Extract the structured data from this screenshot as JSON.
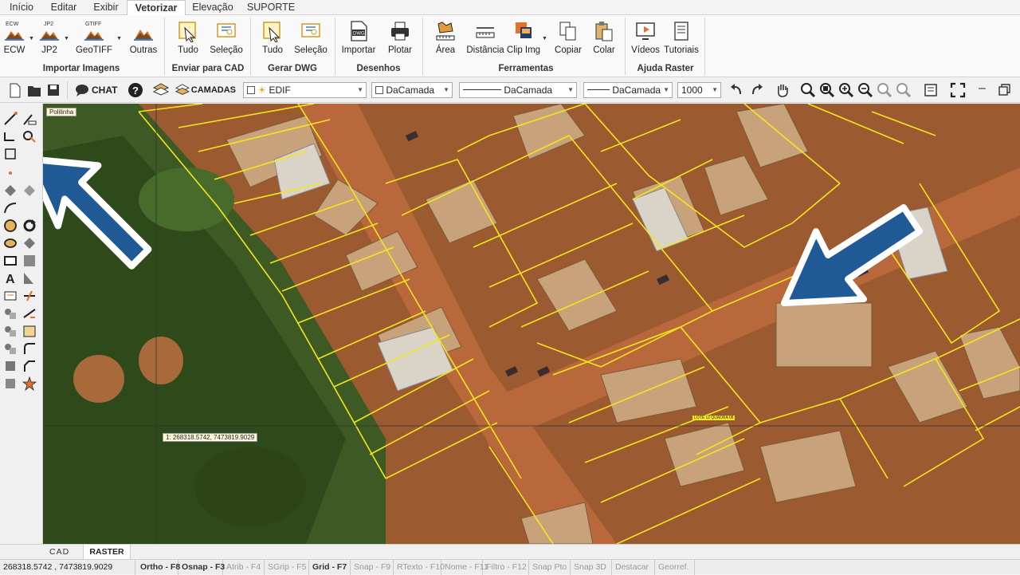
{
  "menu_tabs": [
    "Início",
    "Editar",
    "Exibir",
    "Vetorizar",
    "Elevação",
    "SUPORTE"
  ],
  "active_tab": "Vetorizar",
  "ribbon": {
    "importar": {
      "group": "Importar Imagens",
      "buttons": [
        "ECW",
        "JP2",
        "GeoTIFF",
        "Outras"
      ],
      "badges": [
        "ECW",
        "JP2",
        "GTIFF"
      ]
    },
    "enviar": {
      "group": "Enviar para CAD",
      "buttons": [
        "Tudo",
        "Seleção"
      ]
    },
    "gerar": {
      "group": "Gerar DWG",
      "buttons": [
        "Tudo",
        "Seleção"
      ]
    },
    "desenhos": {
      "group": "Desenhos",
      "buttons": [
        "Importar",
        "Plotar"
      ],
      "badge": "DWG"
    },
    "ferramentas": {
      "group": "Ferramentas",
      "buttons": [
        "Área",
        "Distância",
        "Clip Img",
        "Copiar",
        "Colar"
      ]
    },
    "ajuda": {
      "group": "Ajuda Raster",
      "buttons": [
        "Vídeos",
        "Tutoriais"
      ]
    }
  },
  "toolbar": {
    "chat": "CHAT",
    "camadas": "CAMADAS",
    "layer": "EDIF",
    "color": "DaCamada",
    "linetype": "DaCamada",
    "lineweight": "DaCamada",
    "scale": "1000"
  },
  "canvas": {
    "layer_label": "Polilinha",
    "coord_label": "1: 268318.5742, 7473819.9029",
    "lot_label": "LOTE 12 QUADRA 08"
  },
  "bottom_tabs": [
    "CAD",
    "RASTER"
  ],
  "active_bottom_tab": "RASTER",
  "status": {
    "coords": "268318.5742 , 7473819.9029",
    "items": [
      {
        "label": "Ortho - F8",
        "on": true
      },
      {
        "label": "Osnap - F3",
        "on": true
      },
      {
        "label": "Atrib - F4",
        "on": false
      },
      {
        "label": "SGrip - F5",
        "on": false
      },
      {
        "label": "Grid - F7",
        "on": true
      },
      {
        "label": "Snap - F9",
        "on": false
      },
      {
        "label": "RTexto - F10",
        "on": false
      },
      {
        "label": "Nome - F11",
        "on": false
      },
      {
        "label": "Filtro - F12",
        "on": false
      },
      {
        "label": "Snap Pto",
        "on": false
      },
      {
        "label": "Snap 3D",
        "on": false
      },
      {
        "label": "Destacar",
        "on": false
      },
      {
        "label": "Georref.",
        "on": false
      }
    ]
  },
  "colors": {
    "accent": "#1f5a96",
    "lot_lines": "#f4e61c",
    "dirt": "#a9582c",
    "vegetation": "#3a5a22"
  }
}
